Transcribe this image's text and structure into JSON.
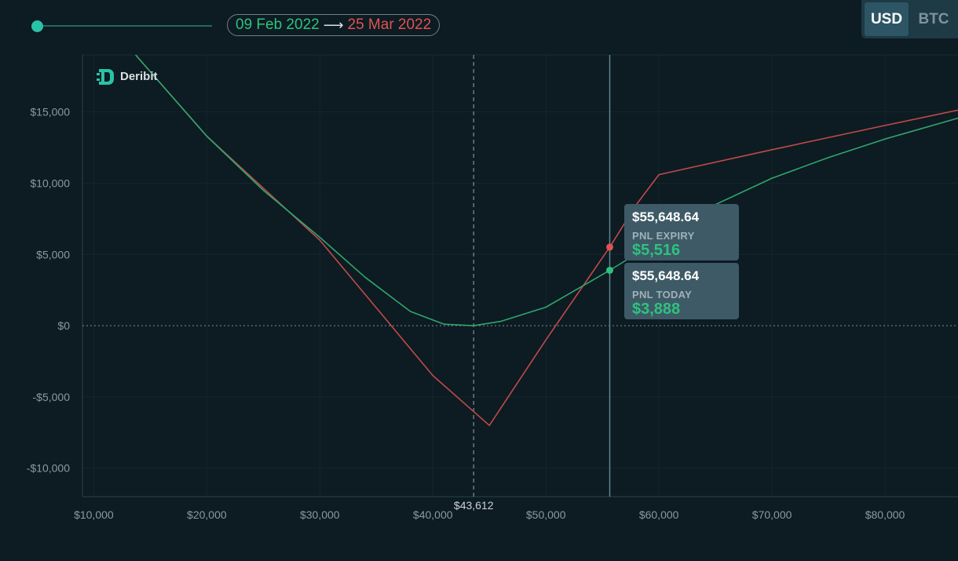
{
  "date_range": {
    "start": "09 Feb 2022",
    "arrow": "⟶",
    "end": "25 Mar 2022"
  },
  "currency_toggle": {
    "options": [
      "USD",
      "BTC"
    ],
    "selected": "USD"
  },
  "logo": {
    "text": "Deribit",
    "icon": "deribit-logo-icon"
  },
  "colors": {
    "background": "#0d1b22",
    "expiry_line": "#c04a4a",
    "today_line": "#2ea66e",
    "accent": "#2ac2a6"
  },
  "tooltips": {
    "expiry": {
      "price": "$55,648.64",
      "label": "PNL EXPIRY",
      "value": "$5,516"
    },
    "today": {
      "price": "$55,648.64",
      "label": "PNL TODAY",
      "value": "$3,888"
    }
  },
  "chart_data": {
    "type": "line",
    "title": "",
    "xlabel": "",
    "ylabel": "",
    "xlim": [
      9000,
      87500
    ],
    "ylim": [
      -12000,
      19000
    ],
    "x_ticks": [
      10000,
      20000,
      30000,
      40000,
      50000,
      60000,
      70000,
      80000
    ],
    "x_tick_labels": [
      "$10,000",
      "$20,000",
      "$30,000",
      "$40,000",
      "$50,000",
      "$60,000",
      "$70,000",
      "$80,000"
    ],
    "y_ticks": [
      15000,
      10000,
      5000,
      0,
      -5000,
      -10000
    ],
    "y_tick_labels": [
      "$15,000",
      "$10,000",
      "$5,000",
      "$0",
      "-$5,000",
      "-$10,000"
    ],
    "markers": [
      {
        "x": 43612,
        "label": "$43,612",
        "style": "dashed"
      },
      {
        "x": 55648.64,
        "label": "",
        "style": "solid"
      }
    ],
    "series": [
      {
        "role": "pnl_expiry",
        "color": "#c04a4a",
        "points": [
          [
            13700,
            19000
          ],
          [
            20000,
            13300
          ],
          [
            30000,
            6000
          ],
          [
            40000,
            -3500
          ],
          [
            45000,
            -7000
          ],
          [
            50000,
            -1000
          ],
          [
            55648.64,
            5516
          ],
          [
            58000,
            8500
          ],
          [
            60000,
            10600
          ],
          [
            70000,
            12350
          ],
          [
            80000,
            14050
          ],
          [
            87500,
            15300
          ]
        ]
      },
      {
        "role": "pnl_today",
        "color": "#2ea66e",
        "points": [
          [
            13700,
            19000
          ],
          [
            20000,
            13300
          ],
          [
            25000,
            9500
          ],
          [
            30000,
            6200
          ],
          [
            34000,
            3400
          ],
          [
            38000,
            1000
          ],
          [
            41000,
            100
          ],
          [
            43612,
            0
          ],
          [
            46000,
            300
          ],
          [
            50000,
            1300
          ],
          [
            55648.64,
            3888
          ],
          [
            60000,
            6000
          ],
          [
            65000,
            8500
          ],
          [
            70000,
            10350
          ],
          [
            75000,
            11800
          ],
          [
            80000,
            13100
          ],
          [
            87500,
            14800
          ]
        ]
      }
    ],
    "grid": true,
    "legend": "none"
  }
}
